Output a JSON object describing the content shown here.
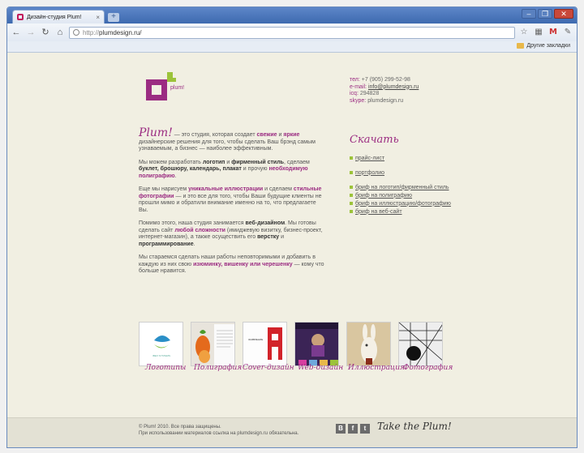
{
  "browser": {
    "tab_title": "Дизайн-студия Plum!",
    "url_protocol": "http://",
    "url_host": "plumdesign.ru/",
    "other_bookmarks": "Другие закладки"
  },
  "logo": {
    "text": "plum!"
  },
  "contacts": {
    "phone_label": "тел:",
    "phone": "+7 (905) 299-52-98",
    "email_label": "e-mail:",
    "email": "info@plumdesign.ru",
    "icq_label": "icq:",
    "icq": "294828",
    "skype_label": "skype:",
    "skype": "plumdesign.ru"
  },
  "about": {
    "brand": "Plum!",
    "p1a": " — это студия, которая создает ",
    "p1b": "свежие",
    "p1c": " и ",
    "p1d": "яркие",
    "p1e": " дизайнерские решения для того, чтобы сделать Ваш брэнд самым узнаваемым, а бизнес — наиболее эффективным.",
    "p2a": "Мы можем разработать ",
    "p2b": "логотип",
    "p2c": " и ",
    "p2d": "фирменный стиль",
    "p2e": ", сделаем ",
    "p2f": "буклет, брошюру, календарь, плакат",
    "p2g": " и прочую ",
    "p2h": "необходимую полиграфию",
    "p2i": ".",
    "p3a": "Еще мы нарисуем ",
    "p3b": "уникальные иллюстрации",
    "p3c": " и сделаем ",
    "p3d": "стильные фотографии",
    "p3e": " — и это все для того, чтобы Ваши будущие клиенты не прошли мимо и обратили внимание именно на то, что предлагаете Вы.",
    "p4a": "Помимо этого, наша студия занимается ",
    "p4b": "веб-дизайном",
    "p4c": ". Мы готовы сделать сайт ",
    "p4d": "любой сложности",
    "p4e": " (имиджевую визитку, бизнес-проект, интернет-магазин), а также осуществить его ",
    "p4f": "верстку",
    "p4g": " и ",
    "p4h": "программирование",
    "p4i": ".",
    "p5a": "Мы стараемся сделать наши работы неповторимыми и добавить в каждую из них свою ",
    "p5b": "изюминку, вишенку или черешенку",
    "p5c": " — кому что больше нравится."
  },
  "download": {
    "title": "Скачать",
    "group1": [
      "прайс-лист"
    ],
    "group2": [
      "портфолио"
    ],
    "group3": [
      "бриф на логотип/фирменный стиль",
      "бриф на полиграфию",
      "бриф на иллюстрацию/фотографию",
      "бриф на веб-сайт"
    ]
  },
  "gallery": [
    {
      "label": "Логотипы",
      "thumb_text": "IBEX SYSTEMS"
    },
    {
      "label": "Полиграфия"
    },
    {
      "label": "Cover-дизайн",
      "thumb_text": "ЗАЯВЛЕНИЕ"
    },
    {
      "label": "Web-дизайн"
    },
    {
      "label": "Иллюстрация"
    },
    {
      "label": "Фотография"
    }
  ],
  "footer": {
    "line1": "© Plum! 2010. Все права защищены.",
    "line2": "При использовании материалов ссылка на plumdesign.ru обязательна.",
    "social": [
      "В",
      "f",
      "t"
    ],
    "tagline": "Take the Plum!"
  },
  "colors": {
    "accent": "#9b2c82",
    "green": "#9cc33a",
    "page_bg": "#f1efe2"
  }
}
